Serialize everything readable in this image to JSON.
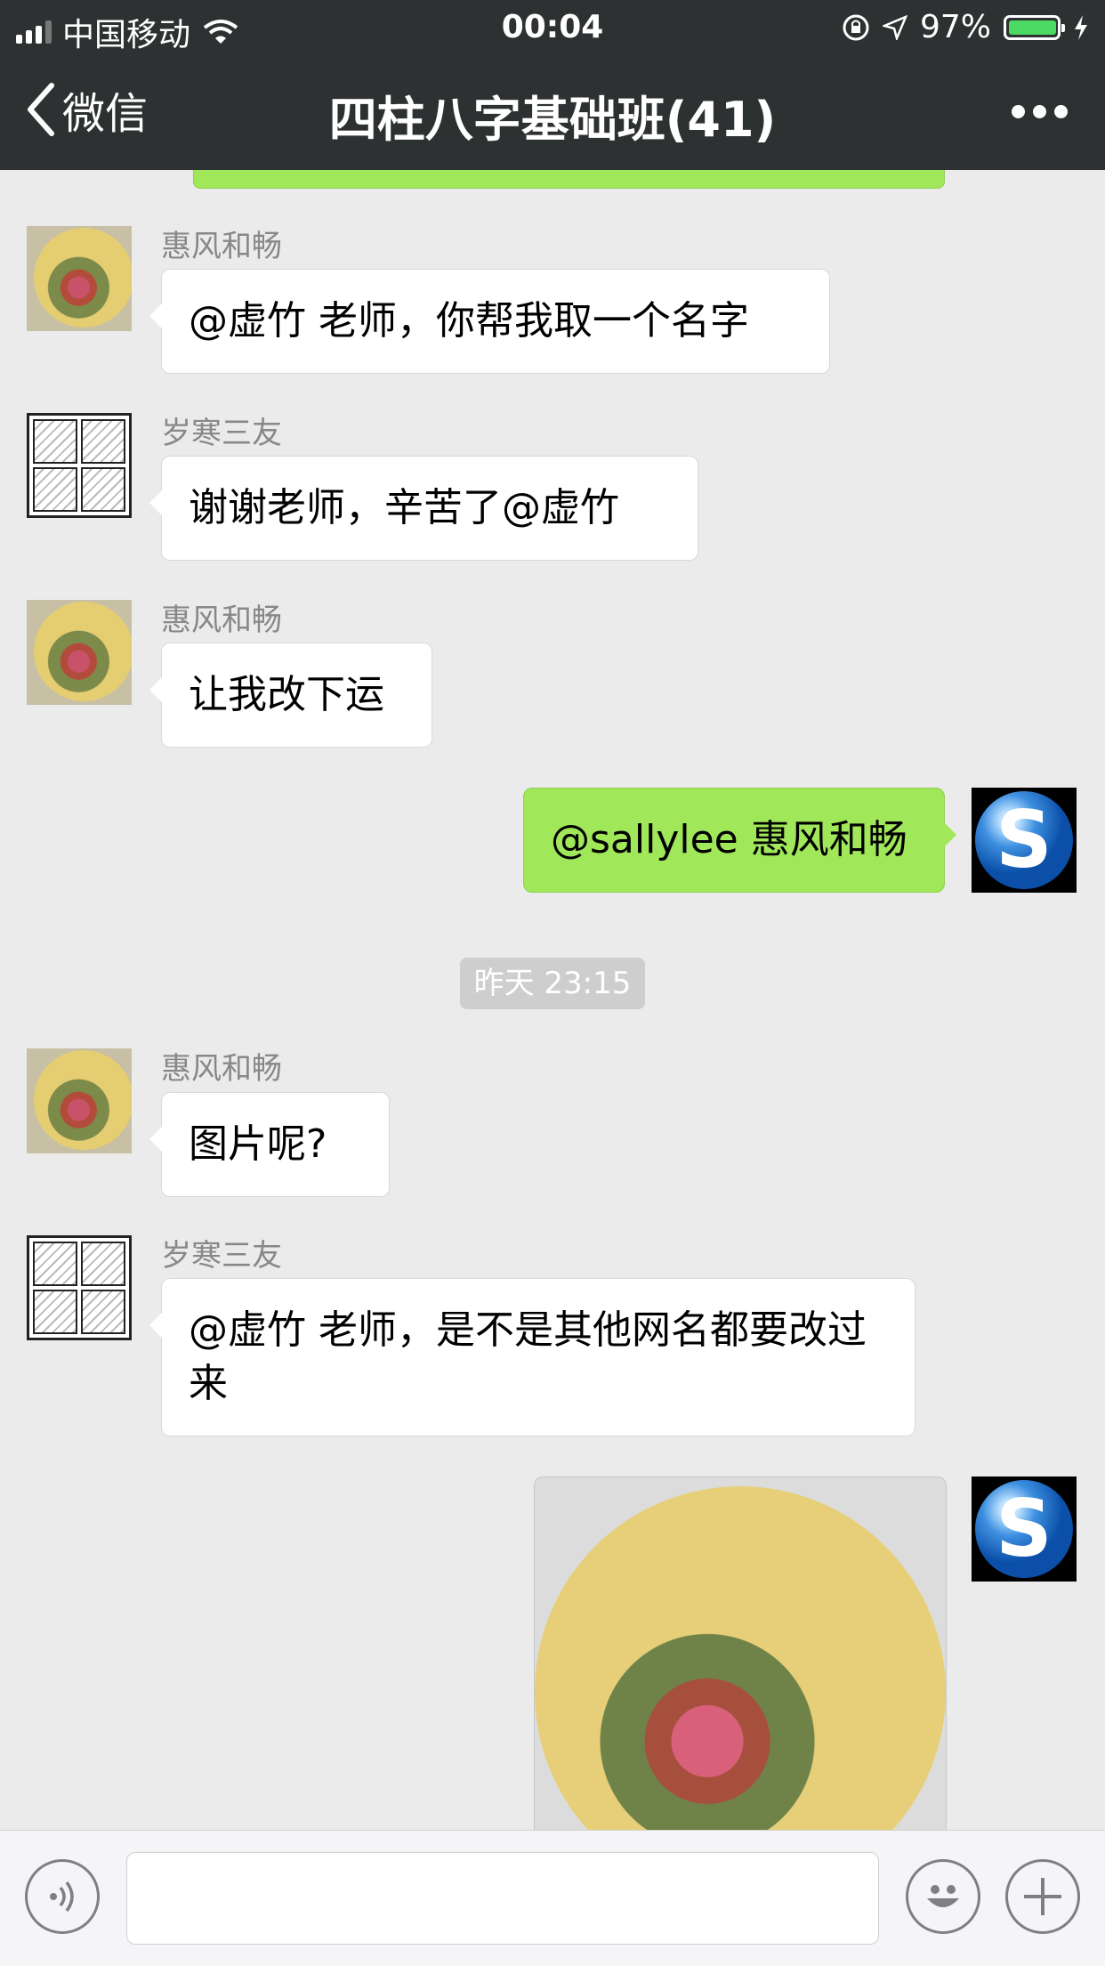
{
  "status_bar": {
    "carrier": "中国移动",
    "time": "00:04",
    "battery": "97%"
  },
  "navbar": {
    "back_label": "微信",
    "title": "四柱八字基础班(41)"
  },
  "messages": [
    {
      "sender": "惠风和畅",
      "text": "@虚竹 老师，你帮我取一个名字"
    },
    {
      "sender": "岁寒三友",
      "text": "谢谢老师，辛苦了@虚竹"
    },
    {
      "sender": "惠风和畅",
      "text": "让我改下运"
    },
    {
      "text": "@sallylee 惠风和畅"
    },
    {
      "sender": "惠风和畅",
      "text": "图片呢?"
    },
    {
      "sender": "岁寒三友",
      "text": "@虚竹 老师，是不是其他网名都要改过来"
    }
  ],
  "timestamp": "昨天 23:15",
  "colors": {
    "outgoing_bubble": "#a0e75a",
    "incoming_bubble": "#ffffff",
    "background": "#ebebeb",
    "nav": "#2e3132"
  },
  "icons": [
    "voice-icon",
    "emoji-icon",
    "plus-icon",
    "back-chevron-icon",
    "more-icon"
  ]
}
